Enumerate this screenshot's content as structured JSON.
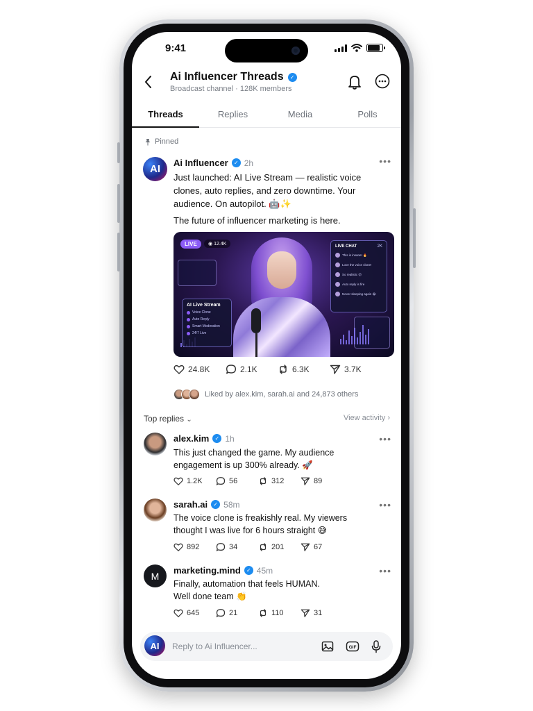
{
  "status": {
    "time": "9:41"
  },
  "channel": {
    "title": "Ai Influencer Threads",
    "subtitle": "Broadcast channel · 128K members"
  },
  "tabs": [
    {
      "label": "Threads",
      "active": true
    },
    {
      "label": "Replies",
      "active": false
    },
    {
      "label": "Media",
      "active": false
    },
    {
      "label": "Polls",
      "active": false
    }
  ],
  "pinned_label": "Pinned",
  "post": {
    "avatar_initials": "AI",
    "author": "Ai Influencer",
    "time": "2h",
    "text": "Just launched: AI Live Stream — realistic voice clones, auto replies, and zero downtime. Your audience. On autopilot. 🤖✨",
    "text2": "The future of influencer marketing is here.",
    "media": {
      "live_label": "LIVE",
      "viewers": "12.4K",
      "stream_card_title": "AI Live Stream",
      "stream_features": [
        "Voice Clone",
        "Auto Reply",
        "Smart Moderation",
        "24/7 Live"
      ],
      "chat_title": "LIVE CHAT",
      "chat_count": "2K",
      "chat_messages": [
        "This is insane! 🔥",
        "Love the voice clone!",
        "So realistic 😮",
        "Auto reply is fire",
        "Never sleeping again 😂"
      ]
    },
    "likes": "24.8K",
    "comments": "2.1K",
    "reposts": "6.3K",
    "shares": "3.7K",
    "liked_by": "Liked by alex.kim, sarah.ai and 24,873 others"
  },
  "top_replies_label": "Top replies",
  "view_activity_label": "View activity",
  "replies": [
    {
      "name": "alex.kim",
      "time": "1h",
      "text": "This just changed the game. My audience engagement is up 300% already. 🚀",
      "likes": "1.2K",
      "comments": "56",
      "reposts": "312",
      "shares": "89"
    },
    {
      "name": "sarah.ai",
      "time": "58m",
      "text": "The voice clone is freakishly real. My viewers thought I was live for 6 hours straight 😅",
      "likes": "892",
      "comments": "34",
      "reposts": "201",
      "shares": "67"
    },
    {
      "name": "marketing.mind",
      "avatar_initial": "M",
      "time": "45m",
      "text": "Finally, automation that feels HUMAN.",
      "text2": "Well done team 👏",
      "likes": "645",
      "comments": "21",
      "reposts": "110",
      "shares": "31"
    }
  ],
  "composer": {
    "avatar_initials": "AI",
    "placeholder": "Reply to Ai Influencer..."
  },
  "icons": {
    "back": "chevron-left-icon",
    "bell": "bell-icon",
    "more": "more-circle-icon",
    "like": "heart-icon",
    "comment": "comment-icon",
    "repost": "repost-icon",
    "share": "send-icon",
    "image": "image-icon",
    "gif": "gif-icon",
    "mic": "microphone-icon"
  },
  "colors": {
    "verified": "#1d8cf0",
    "live": "#8b5cf6"
  }
}
